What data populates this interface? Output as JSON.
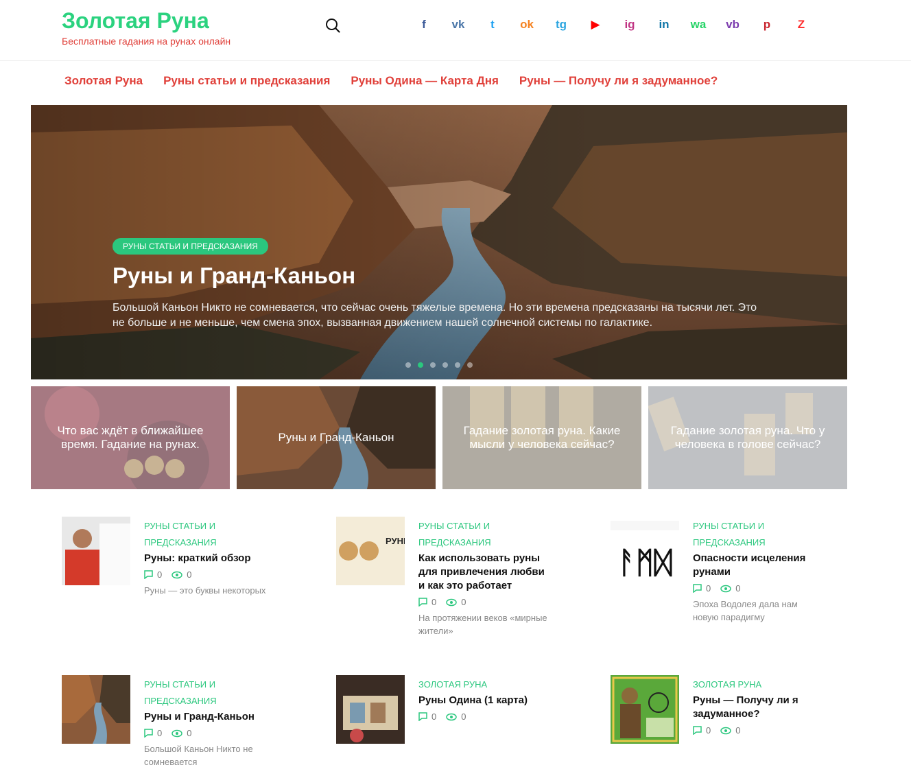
{
  "site": {
    "title": "Золотая Руна",
    "subtitle": "Бесплатные гадания на рунах онлайн",
    "brand_color": "#2bd27f",
    "accent_color": "#e0403a"
  },
  "socials": [
    {
      "name": "facebook-icon",
      "glyph": "f",
      "color": "#3b5998"
    },
    {
      "name": "vk-icon",
      "glyph": "vk",
      "color": "#4a76a8"
    },
    {
      "name": "twitter-icon",
      "glyph": "t",
      "color": "#1da1f2"
    },
    {
      "name": "odnoklassniki-icon",
      "glyph": "ok",
      "color": "#f58220"
    },
    {
      "name": "telegram-icon",
      "glyph": "tg",
      "color": "#2ca5e0"
    },
    {
      "name": "youtube-icon",
      "glyph": "▶",
      "color": "#ff0000"
    },
    {
      "name": "instagram-icon",
      "glyph": "ig",
      "color": "#c13584"
    },
    {
      "name": "linkedin-icon",
      "glyph": "in",
      "color": "#0e76a8"
    },
    {
      "name": "whatsapp-icon",
      "glyph": "wa",
      "color": "#25d366"
    },
    {
      "name": "viber-icon",
      "glyph": "vb",
      "color": "#7d3daf"
    },
    {
      "name": "pinterest-icon",
      "glyph": "p",
      "color": "#c8232c"
    },
    {
      "name": "zen-icon",
      "glyph": "Z",
      "color": "#ff2d2d"
    }
  ],
  "nav": [
    "Золотая Руна",
    "Руны статьи и предсказания",
    "Руны Одина — Карта Дня",
    "Руны — Получу ли я задуманное?"
  ],
  "hero": {
    "tag": "Руны статьи и предсказания",
    "title": "Руны и Гранд-Каньон",
    "excerpt": "Большой Каньон Никто не сомневается, что сейчас очень тяжелые времена. Но эти времена предсказаны на тысячи лет. Это не больше и не меньше, чем смена эпох, вызванная движением нашей солнечной системы по галактике.",
    "slides_total": 6,
    "active_slide": 2
  },
  "minis": [
    {
      "title": "Что вас ждёт в ближайшее время. Гадание на рунах."
    },
    {
      "title": "Руны и Гранд-Каньон"
    },
    {
      "title": "Гадание золотая руна. Какие мысли у человека сейчас?"
    },
    {
      "title": "Гадание золотая руна. Что у человека в голове сейчас?"
    }
  ],
  "posts": [
    {
      "category": "Руны статьи и предсказания",
      "title": "Руны: краткий обзор",
      "comments": "0",
      "views": "0",
      "excerpt": "Руны — это буквы некоторых"
    },
    {
      "category": "Руны статьи и предсказания",
      "title": "Как использовать руны для привлечения любви и как это работает",
      "comments": "0",
      "views": "0",
      "excerpt": "На протяжении веков «мирные жители»",
      "thumb_text": "РУНЫ"
    },
    {
      "category": "Руны статьи и предсказания",
      "title": "Опасности исцеления рунами",
      "comments": "0",
      "views": "0",
      "excerpt": "Эпоха Водолея дала нам новую парадигму",
      "thumb_text": "ᚨᛗᛞ"
    },
    {
      "category": "Руны статьи и предсказания",
      "title": "Руны и Гранд-Каньон",
      "comments": "0",
      "views": "0",
      "excerpt": "Большой Каньон Никто не сомневается"
    },
    {
      "category": "Золотая Руна",
      "title": "Руны Одина (1 карта)",
      "comments": "0",
      "views": "0",
      "excerpt": ""
    },
    {
      "category": "Золотая Руна",
      "title": "Руны — Получу ли я задуманное?",
      "comments": "0",
      "views": "0",
      "excerpt": ""
    }
  ]
}
